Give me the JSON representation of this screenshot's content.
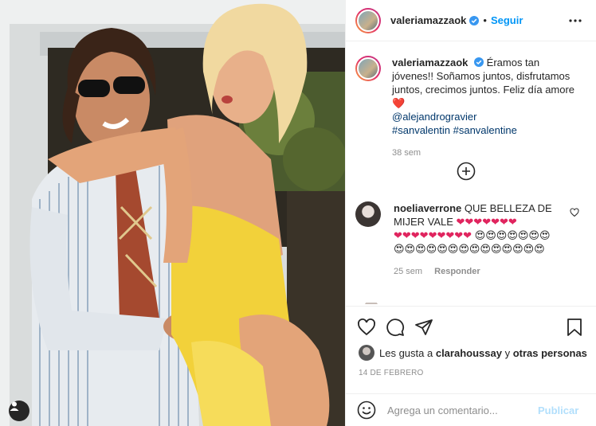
{
  "post": {
    "username": "valeriamazzaok",
    "follow_label": "Seguir",
    "separator": "•",
    "caption": {
      "text": "Éramos tan jóvenes!! Soñamos juntos, disfrutamos juntos, crecimos juntos. Feliz día amore",
      "heart": "❤️",
      "mention": "@alejandrogravier",
      "hashtags": "#sanvalentin #sanvalentine",
      "time": "38 sem"
    },
    "comments": [
      {
        "username": "noeliaverrone",
        "text": "QUE BELLEZA DE MIJER VALE",
        "hearts_line1": "❤❤❤❤❤❤❤",
        "hearts_line2": "❤❤❤❤❤❤❤❤❤",
        "faces": "😍😍😍😍😍😍😍😍😍😍😍😍😍😍😍😍😍😍😍😍😍",
        "time": "25 sem",
        "reply_label": "Responder"
      }
    ],
    "likes": {
      "prefix": "Les gusta a",
      "user": "clarahoussay",
      "connector": "y",
      "others": "otras personas"
    },
    "date": "14 de febrero",
    "comment_input": {
      "placeholder": "Agrega un comentario...",
      "publish_label": "Publicar"
    }
  },
  "icons": {
    "verified": "verified-badge-icon",
    "more": "more-options-icon",
    "load_more": "plus-circle-icon",
    "like": "heart-outline-icon",
    "comment": "comment-bubble-icon",
    "share": "paper-plane-icon",
    "save": "bookmark-icon",
    "emoji": "smiley-icon",
    "tag": "user-tag-icon"
  },
  "colors": {
    "link": "#00376b",
    "follow": "#0095f6",
    "heart": "#e0245e",
    "swimsuit": "#f2d13a"
  }
}
